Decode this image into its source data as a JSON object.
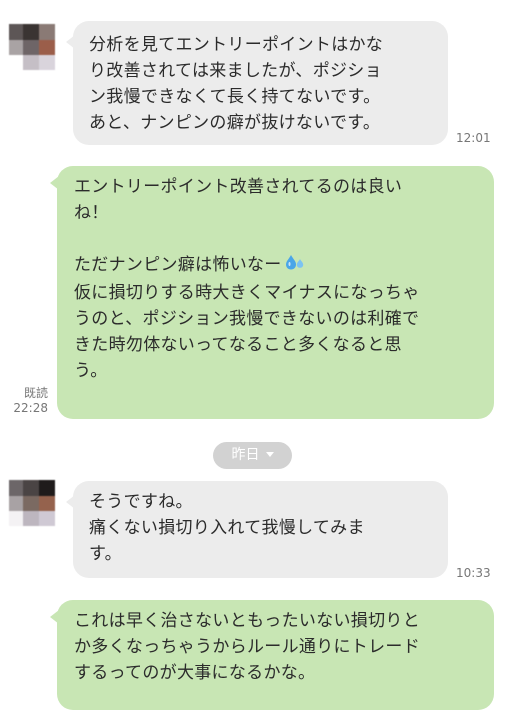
{
  "messages": [
    {
      "lines": [
        "分析を見てエントリーポイントはかな",
        "り改善されては来ましたが、ポジショ",
        "ン我慢できなくて長く持てないです。",
        "あと、ナンピンの癖が抜けないです。"
      ],
      "time": "12:01"
    },
    {
      "lines": [
        "エントリーポイント改善されてるのは良い",
        "ね！",
        "",
        "ただナンピン癖は怖いなー",
        "仮に損切りする時大きくマイナスになっちゃ",
        "うのと、ポジション我慢できないのは利確で",
        "きた時勿体ないってなること多くなると思",
        "う。"
      ],
      "read_label": "既読",
      "time": "22:28",
      "emoji": "sweat-droplets-icon"
    },
    {
      "lines": [
        "そうですね。",
        "痛くない損切り入れて我慢してみま",
        "す。"
      ],
      "time": "10:33"
    },
    {
      "lines": [
        "これは早く治さないともったいない損切りと",
        "か多くなっちゃうからルール通りにトレード",
        "するってのが大事になるかな。"
      ]
    }
  ],
  "date_separator": "昨日",
  "colors": {
    "incoming_bubble": "#ececec",
    "outgoing_bubble": "#c8e6b4",
    "date_pill": "#d2d2d2",
    "emoji": "#4aa6e8"
  }
}
